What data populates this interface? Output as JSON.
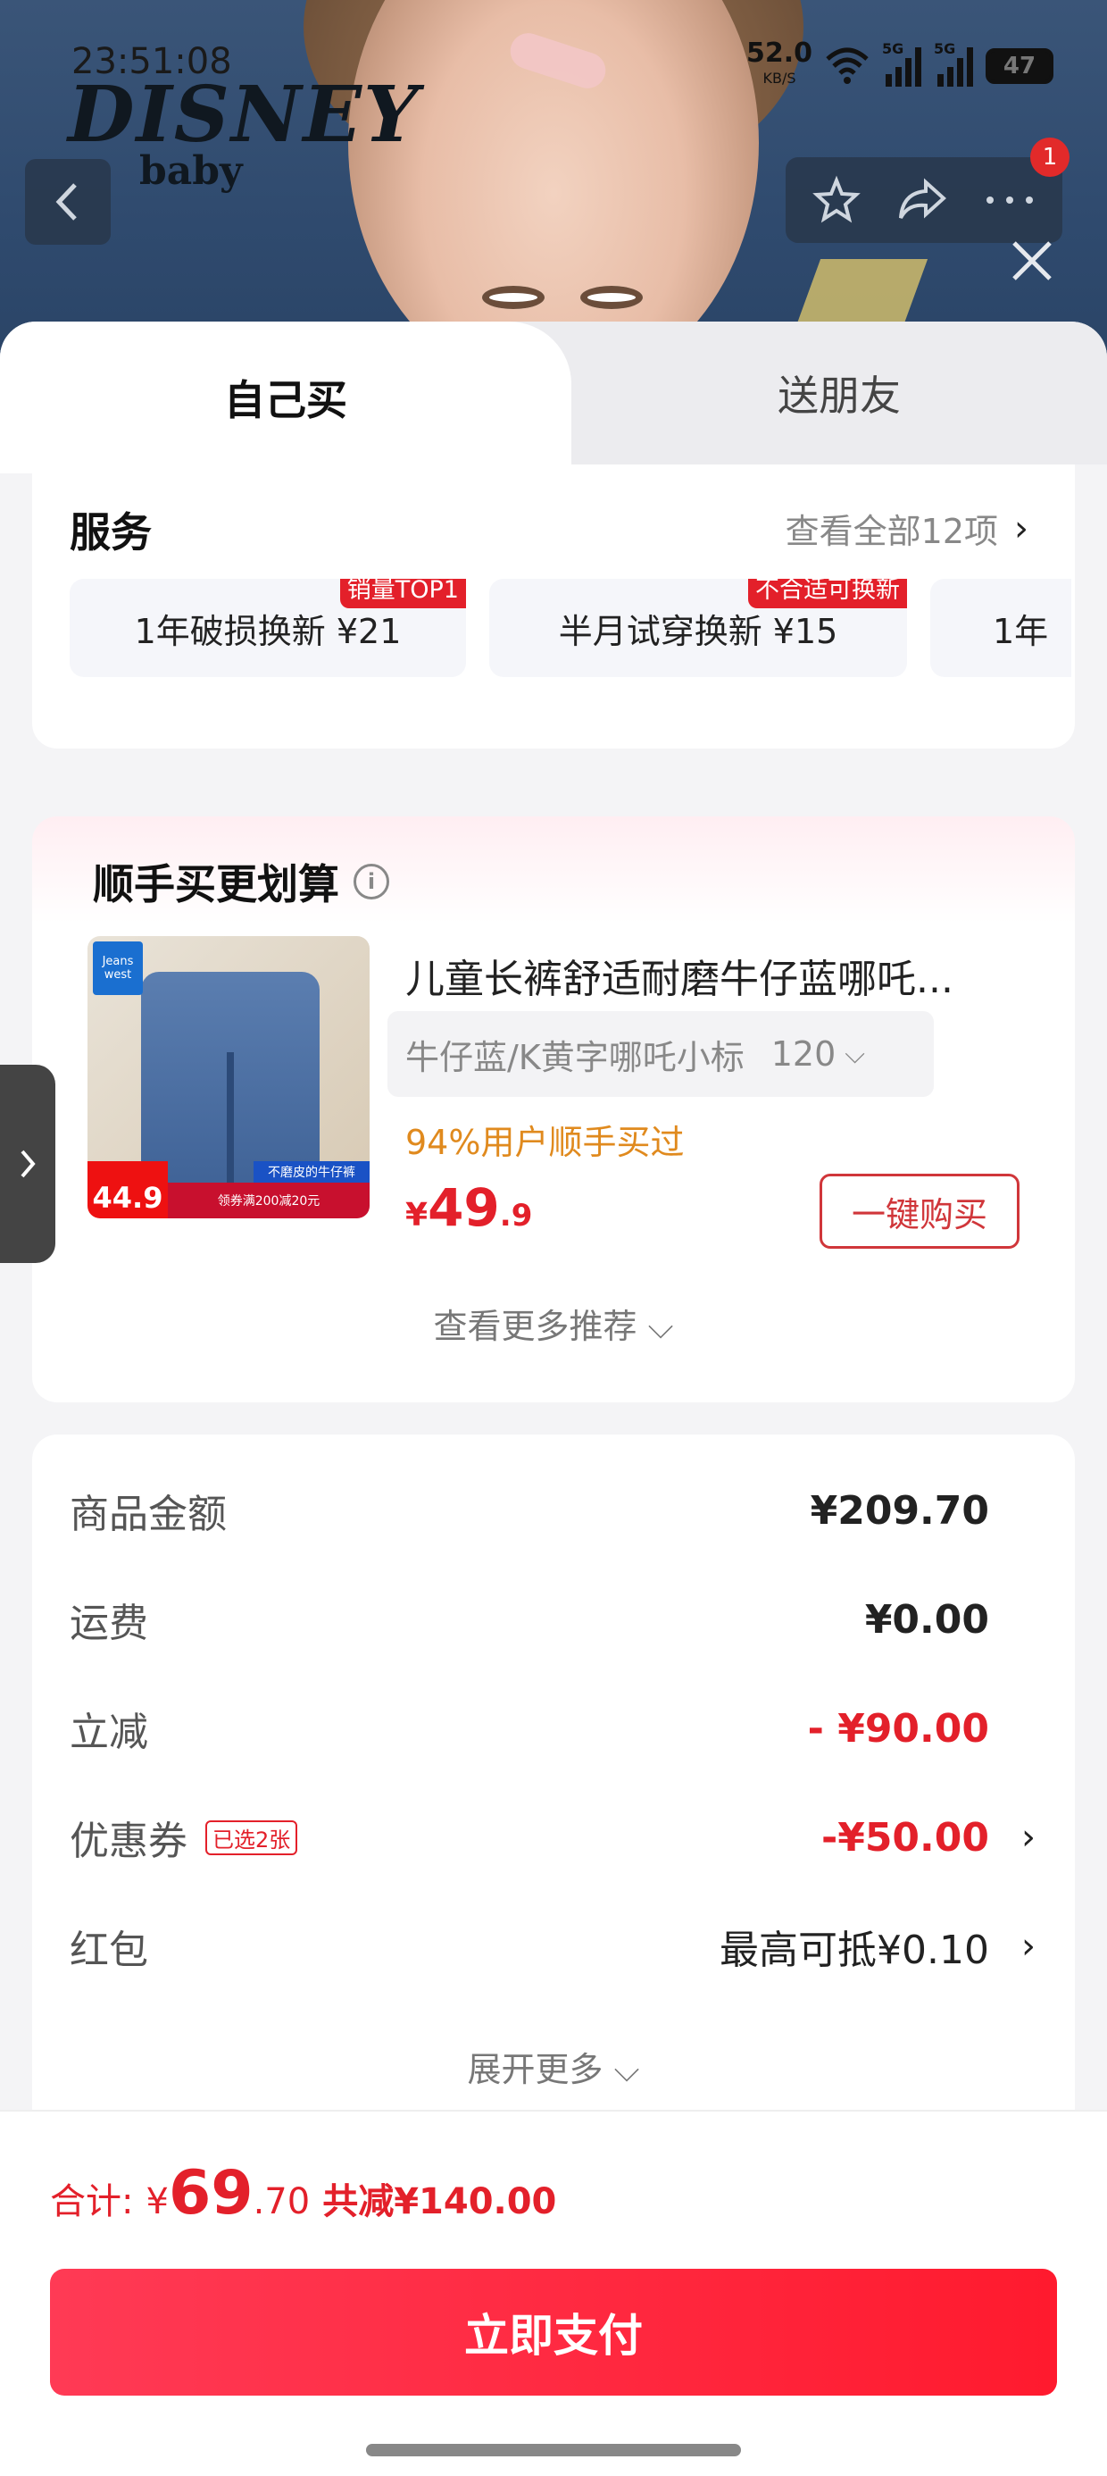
{
  "status": {
    "time": "23:51:08",
    "net_speed": "52.0",
    "net_unit": "KB/S",
    "sig1": "5G",
    "sig2": "5G",
    "battery": "47"
  },
  "brand": {
    "line1": "DISNEY",
    "line2": "baby"
  },
  "nav": {
    "badge_count": "1"
  },
  "tabs": {
    "self": "自己买",
    "gift": "送朋友"
  },
  "service": {
    "title": "服务",
    "more": "查看全部12项",
    "items": [
      {
        "label": "1年破损换新  ¥21",
        "tag": "销量TOP1"
      },
      {
        "label": "半月试穿换新  ¥15",
        "tag": "不合适可换新"
      },
      {
        "label": "1年",
        "tag": ""
      }
    ]
  },
  "recommend": {
    "title": "顺手买更划算",
    "thumb_brand": "Jeans west",
    "thumb_price": "44.9",
    "thumb_strip": "领券满200减20元",
    "thumb_banner": "不磨皮的牛仔裤",
    "product_name": "儿童长裤舒适耐磨牛仔蓝哪吒...",
    "sku": "牛仔蓝/K黄字哪吒小标",
    "sku_size": "120",
    "bought": "94%用户顺手买过",
    "price_cur": "¥",
    "price_int": "49",
    "price_dec": ".9",
    "buy_label": "一键购买",
    "more_label": "查看更多推荐"
  },
  "fees": {
    "goods_label": "商品金额",
    "goods_value": "¥209.70",
    "ship_label": "运费",
    "ship_value": "¥0.00",
    "discount_label": "立减",
    "discount_value": "- ¥90.00",
    "coupon_label": "优惠券",
    "coupon_tag": "已选2张",
    "coupon_value": "-¥50.00",
    "redpacket_label": "红包",
    "redpacket_value": "最高可抵¥0.10",
    "expand_label": "展开更多"
  },
  "footer": {
    "total_label": "合计:",
    "total_cur": "¥",
    "total_int": "69",
    "total_dec": ".70",
    "save_text": "共减¥140.00",
    "pay_label": "立即支付"
  },
  "colors": {
    "accent": "#e3202a",
    "pay_gradient_start": "#ff3a55",
    "pay_gradient_end": "#ff1a2e"
  }
}
